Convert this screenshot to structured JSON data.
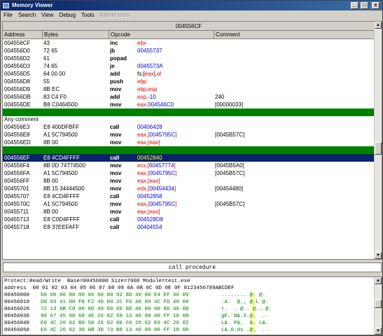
{
  "window": {
    "title": "Memory Viewer",
    "minimize": "_",
    "maximize": "□",
    "close": "x"
  },
  "menu": [
    {
      "label": "File",
      "disabled": false
    },
    {
      "label": "Search",
      "disabled": false
    },
    {
      "label": "View",
      "disabled": false
    },
    {
      "label": "Debug",
      "disabled": false
    },
    {
      "label": "Tools",
      "disabled": false
    },
    {
      "label": "Kernel tools",
      "disabled": true
    }
  ],
  "disasm": {
    "top_address": "004556CF",
    "columns": {
      "address": "Address",
      "bytes": "Bytes",
      "opcode": "Opcode",
      "comment": "Comment"
    },
    "rows_a": [
      {
        "addr": "004556CF",
        "bytes": "43",
        "op": "inc",
        "args": [
          {
            "t": "ebx",
            "c": "r"
          }
        ],
        "cmt": ""
      },
      {
        "addr": "004556D0",
        "bytes": "72 65",
        "op": "jb",
        "args": [
          {
            "t": "00455737",
            "c": "b"
          }
        ],
        "cmt": ""
      },
      {
        "addr": "004556D2",
        "bytes": "61",
        "op": "popad",
        "args": [],
        "cmt": ""
      },
      {
        "addr": "004556D3",
        "bytes": "74 65",
        "op": "je",
        "args": [
          {
            "t": "0045573A",
            "c": "b"
          }
        ],
        "cmt": ""
      },
      {
        "addr": "004556D5",
        "bytes": "64 00 00",
        "op": "add",
        "args": [
          {
            "t": "fs:[",
            "c": ""
          },
          {
            "t": "eax",
            "c": "r"
          },
          {
            "t": "],",
            "c": ""
          },
          {
            "t": "al",
            "c": "r"
          }
        ],
        "cmt": ""
      },
      {
        "addr": "004556D8",
        "bytes": "55",
        "op": "push",
        "args": [
          {
            "t": "ebp",
            "c": "r"
          }
        ],
        "cmt": ""
      },
      {
        "addr": "004556D9",
        "bytes": "8B EC",
        "op": "mov",
        "args": [
          {
            "t": "ebp,esp",
            "c": "r"
          }
        ],
        "cmt": ""
      },
      {
        "addr": "004556DB",
        "bytes": "83 C4 F0",
        "op": "add",
        "args": [
          {
            "t": "esp,",
            "c": "r"
          },
          {
            "t": "-10",
            "c": "b"
          }
        ],
        "cmt": "240"
      },
      {
        "addr": "004556DE",
        "bytes": "B8 C0464500",
        "op": "mov",
        "args": [
          {
            "t": "eax,",
            "c": "r"
          },
          {
            "t": "004546C0",
            "c": "b"
          }
        ],
        "cmt": "[00000033]"
      }
    ],
    "label": "Any comment",
    "rows_b": [
      {
        "addr": "004556E3",
        "bytes": "E8 400DFBFF",
        "op": "call",
        "args": [
          {
            "t": "00406428",
            "c": "b"
          }
        ],
        "cmt": ""
      },
      {
        "addr": "004556E8",
        "bytes": "A1 5C794500",
        "op": "mov",
        "args": [
          {
            "t": "eax,[",
            "c": "r"
          },
          {
            "t": "0045795C",
            "c": "b"
          },
          {
            "t": "]",
            "c": "r"
          }
        ],
        "cmt": "[0045B57C]"
      },
      {
        "addr": "004556ED",
        "bytes": "8B 00",
        "op": "mov",
        "args": [
          {
            "t": "eax,[eax]",
            "c": "r"
          }
        ],
        "cmt": ""
      }
    ],
    "selected": {
      "addr": "004556EF",
      "bytes": "E8 4CD4FFFF",
      "op": "call",
      "args": [
        {
          "t": "00452840",
          "c": ""
        }
      ],
      "cmt": ""
    },
    "rows_c": [
      {
        "addr": "004556F4",
        "bytes": "8B 0D 74774500",
        "op": "mov",
        "args": [
          {
            "t": "ecx,[",
            "c": "r"
          },
          {
            "t": "00457774",
            "c": "b"
          },
          {
            "t": "]",
            "c": "r"
          }
        ],
        "cmt": "[0045B5A0]"
      },
      {
        "addr": "004556FA",
        "bytes": "A1 5C794500",
        "op": "mov",
        "args": [
          {
            "t": "eax,[",
            "c": "r"
          },
          {
            "t": "0045795C",
            "c": "b"
          },
          {
            "t": "]",
            "c": "r"
          }
        ],
        "cmt": "[0045B57C]"
      },
      {
        "addr": "004556FF",
        "bytes": "8B 00",
        "op": "mov",
        "args": [
          {
            "t": "eax,[eax]",
            "c": "r"
          }
        ],
        "cmt": ""
      },
      {
        "addr": "00455701",
        "bytes": "8B 15 34444500",
        "op": "mov",
        "args": [
          {
            "t": "edx,[",
            "c": "r"
          },
          {
            "t": "00454434",
            "c": "b"
          },
          {
            "t": "]",
            "c": "r"
          }
        ],
        "cmt": "[00454480]"
      },
      {
        "addr": "00455707",
        "bytes": "E8 4CD4FFFF",
        "op": "call",
        "args": [
          {
            "t": "00452858",
            "c": "b"
          }
        ],
        "cmt": ""
      },
      {
        "addr": "0045570C",
        "bytes": "A1 5C794500",
        "op": "mov",
        "args": [
          {
            "t": "eax,[",
            "c": "r"
          },
          {
            "t": "0045795C",
            "c": "b"
          },
          {
            "t": "]",
            "c": "r"
          }
        ],
        "cmt": "[0045B57C]"
      },
      {
        "addr": "00455711",
        "bytes": "8B 00",
        "op": "mov",
        "args": [
          {
            "t": "eax,[eax]",
            "c": "r"
          }
        ],
        "cmt": ""
      },
      {
        "addr": "00455713",
        "bytes": "E8 C0D4FFFF",
        "op": "call",
        "args": [
          {
            "t": "004528D8",
            "c": "b"
          }
        ],
        "cmt": ""
      },
      {
        "addr": "00455718",
        "bytes": "E8 37EEFAFF",
        "op": "call",
        "args": [
          {
            "t": "00404554",
            "c": "b"
          }
        ],
        "cmt": ""
      }
    ]
  },
  "status_text": "call procedure",
  "hex": {
    "info": "Protect:Read/Write  Base=00456000 Size=7000 Module=test.exe",
    "header": "address  00 01 02 03 04 05 06 07 08 09 0A 0B 0C 0D 0E 0F 0123456789ABCDEF",
    "rows": [
      {
        "addr": "00456000",
        "bytes": "00 00 00 00 00 00 00 00 02 8D 40 00 E4 EF 40 00",
        "ascii": "........ @. @."
      },
      {
        "addr": "00456010",
        "bytes": "D0 03 41 00 F8 F2 40 00 2C F6 40 00 4C FD 40 00",
        "ascii": ".A.  @., @.L @."
      },
      {
        "addr": "00456020",
        "bytes": "72 13 8B C0 00 8D 40 00 00 8D 40 00 00 8D 40 00",
        "ascii": "r.  . @.. @.. @."
      },
      {
        "addr": "00456030",
        "bytes": "90 67 45 00 60 4E 26 02 58 13 40 00 00 FF 10 00",
        "ascii": "gE.`N&.X.@.  .."
      },
      {
        "addr": "00456040",
        "bytes": "E0 4C 26 02 B0 50 26 02 00 C0 26 02 E0 4C 26 02",
        "ascii": "L&. P&.  &. L&."
      },
      {
        "addr": "00456050",
        "bytes": "E0 4C 26 02 30 0B 30 73 B8 13 40 00 00 FF 18 00",
        "ascii": "L&.0.0s .@.  .."
      }
    ]
  }
}
